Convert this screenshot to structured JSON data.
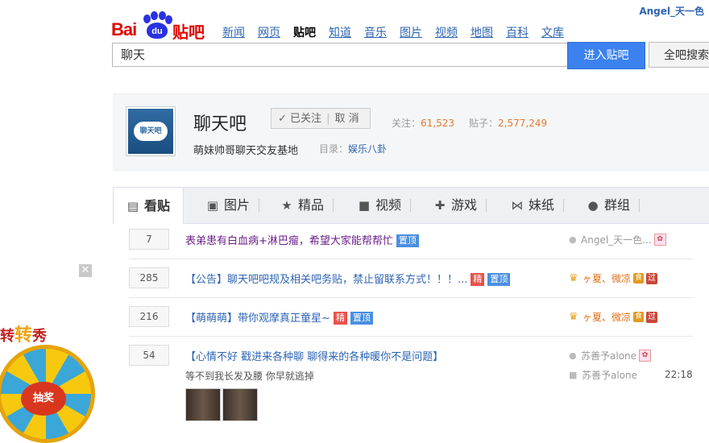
{
  "header": {
    "logo_bai": "Bai",
    "logo_du": "du",
    "logo_tieba": "贴吧",
    "nav": [
      {
        "label": "新闻",
        "active": false
      },
      {
        "label": "网页",
        "active": false
      },
      {
        "label": "贴吧",
        "active": true
      },
      {
        "label": "知道",
        "active": false
      },
      {
        "label": "音乐",
        "active": false
      },
      {
        "label": "图片",
        "active": false
      },
      {
        "label": "视频",
        "active": false
      },
      {
        "label": "地图",
        "active": false
      },
      {
        "label": "百科",
        "active": false
      },
      {
        "label": "文库",
        "active": false
      }
    ],
    "user": "Angel_天一色"
  },
  "search": {
    "value": "聊天",
    "enter_label": "进入贴吧",
    "all_label": "全吧搜索"
  },
  "forum": {
    "avatar_text": "聊天吧",
    "name": "聊天吧",
    "followed_label": "已关注",
    "unfollow_label": "取 消",
    "follow_stat_label": "关注：",
    "follow_count": "61,523",
    "post_stat_label": "贴子：",
    "post_count": "2,577,249",
    "slogan": "萌妹帅哥聊天交友基地",
    "category_label": "目录：",
    "category": "娱乐八卦"
  },
  "tabs": [
    {
      "label": "看贴",
      "icon": "document-icon"
    },
    {
      "label": "图片",
      "icon": "image-icon"
    },
    {
      "label": "精品",
      "icon": "star-icon"
    },
    {
      "label": "视频",
      "icon": "video-icon"
    },
    {
      "label": "游戏",
      "icon": "gamepad-icon"
    },
    {
      "label": "妹纸",
      "icon": "bow-icon"
    },
    {
      "label": "群组",
      "icon": "chat-icon"
    }
  ],
  "threads": [
    {
      "replies": "7",
      "title": "表弟患有白血病+淋巴瘤，希望大家能帮帮忙",
      "tags": [
        "置顶"
      ],
      "author": "Angel_天一色..."
    },
    {
      "replies": "285",
      "title": "【公告】聊天吧吧规及相关吧务贴，禁止留联系方式！！！...",
      "tags": [
        "精",
        "置顶"
      ],
      "author": "ヶ夏、微凉"
    },
    {
      "replies": "216",
      "title": "【萌萌萌】带你观摩真正童星~",
      "tags": [
        "精",
        "置顶"
      ],
      "author": "ヶ夏、微凉"
    },
    {
      "replies": "54",
      "title": "【心情不好  戳进来各种聊  聊得来的各种暖你不是问题】",
      "author": "苏善予alone",
      "abstract": "等不到我长发及腰  你早就逃掉",
      "last_reply_user": "苏善予alone",
      "last_reply_time": "22:18"
    }
  ],
  "badges": {
    "flower": "✿",
    "food": "食",
    "guo": "过"
  },
  "promo": {
    "text_left": "转",
    "text_mid": "转",
    "text_right": "秀",
    "wheel_label": "抽奖",
    "close": "✕"
  }
}
